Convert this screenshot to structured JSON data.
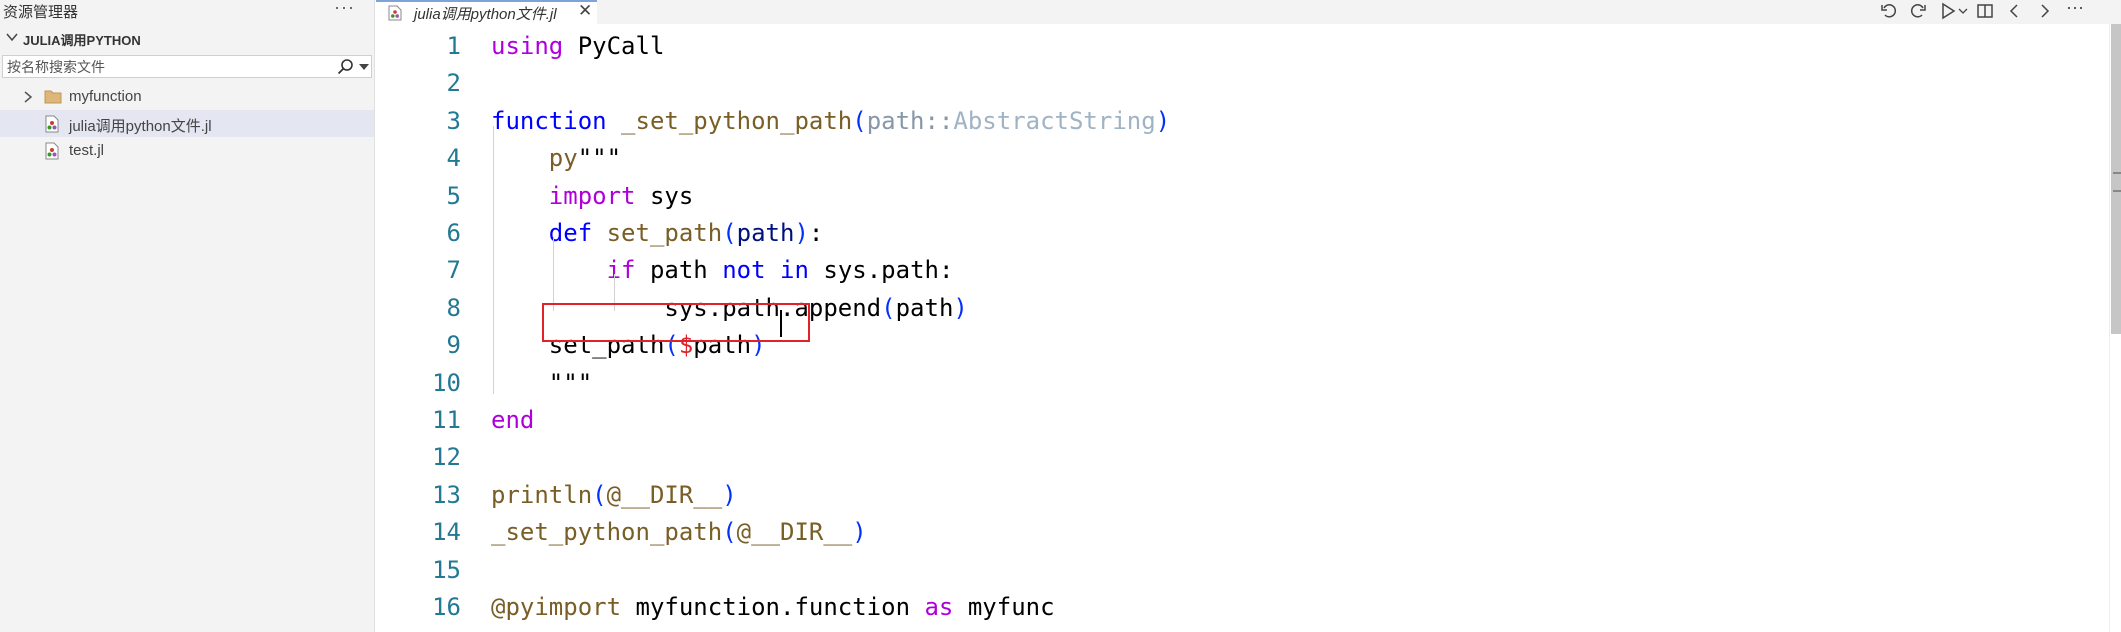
{
  "sidebar": {
    "title": "资源管理器",
    "more": "···",
    "folder_title": "JULIA调用PYTHON",
    "search_placeholder": "按名称搜索文件",
    "items": [
      {
        "label": "myfunction",
        "type": "folder",
        "selected": false
      },
      {
        "label": "julia调用python文件.jl",
        "type": "julia-file",
        "selected": true
      },
      {
        "label": "test.jl",
        "type": "julia-file",
        "selected": false
      }
    ]
  },
  "tab": {
    "label": "julia调用python文件.jl",
    "close": "✕"
  },
  "toolbar": {
    "icons": [
      "undo-icon",
      "redo-icon",
      "run-icon",
      "run-dropdown-icon",
      "split-editor-icon",
      "back-icon",
      "forward-icon",
      "more-actions-icon"
    ],
    "more": "···"
  },
  "editor": {
    "line_numbers": [
      "1",
      "2",
      "3",
      "4",
      "5",
      "6",
      "7",
      "8",
      "9",
      "10",
      "11",
      "12",
      "13",
      "14",
      "15",
      "16"
    ],
    "lines": [
      [
        {
          "t": "using",
          "c": "t-ctl"
        },
        {
          "t": " PyCall"
        }
      ],
      [],
      [
        {
          "t": "function",
          "c": "t-key"
        },
        {
          "t": " "
        },
        {
          "t": "_set_python_path",
          "c": "t-fn"
        },
        {
          "t": "(",
          "c": "t-brk1"
        },
        {
          "t": "path",
          "c": "t-gray"
        },
        {
          "t": "::",
          "c": "t-gray"
        },
        {
          "t": "AbstractString",
          "c": "t-type"
        },
        {
          "t": ")",
          "c": "t-brk1"
        }
      ],
      [
        {
          "t": "    "
        },
        {
          "t": "py",
          "c": "t-fn"
        },
        {
          "t": "\"\"\""
        }
      ],
      [
        {
          "t": "    "
        },
        {
          "t": "import",
          "c": "t-ctl"
        },
        {
          "t": " sys"
        }
      ],
      [
        {
          "t": "    "
        },
        {
          "t": "def",
          "c": "t-key"
        },
        {
          "t": " "
        },
        {
          "t": "set_path",
          "c": "t-fn"
        },
        {
          "t": "(",
          "c": "t-brk1"
        },
        {
          "t": "path",
          "c": "t-param"
        },
        {
          "t": ")",
          "c": "t-brk1"
        },
        {
          "t": ":"
        }
      ],
      [
        {
          "t": "        "
        },
        {
          "t": "if",
          "c": "t-ctl"
        },
        {
          "t": " path "
        },
        {
          "t": "not",
          "c": "t-key"
        },
        {
          "t": " "
        },
        {
          "t": "in",
          "c": "t-key"
        },
        {
          "t": " sys.path:"
        }
      ],
      [
        {
          "t": "            sys.path.append"
        },
        {
          "t": "(",
          "c": "t-brk1"
        },
        {
          "t": "path"
        },
        {
          "t": ")",
          "c": "t-brk1"
        }
      ],
      [
        {
          "t": "    set_path"
        },
        {
          "t": "(",
          "c": "t-brk1"
        },
        {
          "t": "$",
          "c": "t-interp"
        },
        {
          "t": "path"
        },
        {
          "t": ")",
          "c": "t-brk1"
        }
      ],
      [
        {
          "t": "    \"\"\""
        }
      ],
      [
        {
          "t": "end",
          "c": "t-ctl"
        }
      ],
      [],
      [
        {
          "t": "println",
          "c": "t-fn"
        },
        {
          "t": "(",
          "c": "t-brk1"
        },
        {
          "t": "@__DIR__",
          "c": "t-fn"
        },
        {
          "t": ")",
          "c": "t-brk1"
        }
      ],
      [
        {
          "t": "_set_python_path",
          "c": "t-fn"
        },
        {
          "t": "(",
          "c": "t-brk1"
        },
        {
          "t": "@__DIR__",
          "c": "t-fn"
        },
        {
          "t": ")",
          "c": "t-brk1"
        }
      ],
      [],
      [
        {
          "t": "@pyimport",
          "c": "t-fn"
        },
        {
          "t": " myfunction.function "
        },
        {
          "t": "as",
          "c": "t-ctl"
        },
        {
          "t": " myfunc"
        }
      ]
    ],
    "highlighted_line": 9,
    "cursor_line": 9
  },
  "colors": {
    "sidebar_bg": "#f3f3f3",
    "selected_bg": "#e4e6f1",
    "line_number": "#237893",
    "highlight_box": "#e0232a"
  }
}
